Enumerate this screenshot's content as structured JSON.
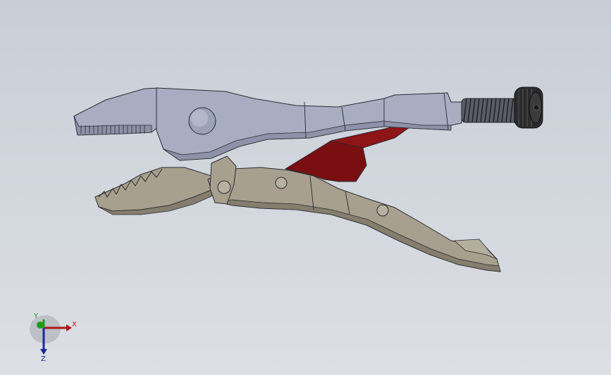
{
  "viewport": {
    "background_top": "#c9ced6",
    "background_bottom": "#dcdfe4"
  },
  "model": {
    "colors": {
      "upper_handle": "#a9adc2",
      "upper_handle_shade": "#8e92a8",
      "lower_handle": "#a7a08e",
      "lower_handle_shade": "#857e6e",
      "release_lever": "#7a0f12",
      "screw_knob": "#2b2b2b",
      "edges": "#2a2a30"
    }
  },
  "triad": {
    "x_label": "X",
    "y_label": "Y",
    "z_label": "Z",
    "x_color": "#b01818",
    "y_color": "#1f9a1f",
    "z_color": "#1a2a9a"
  }
}
